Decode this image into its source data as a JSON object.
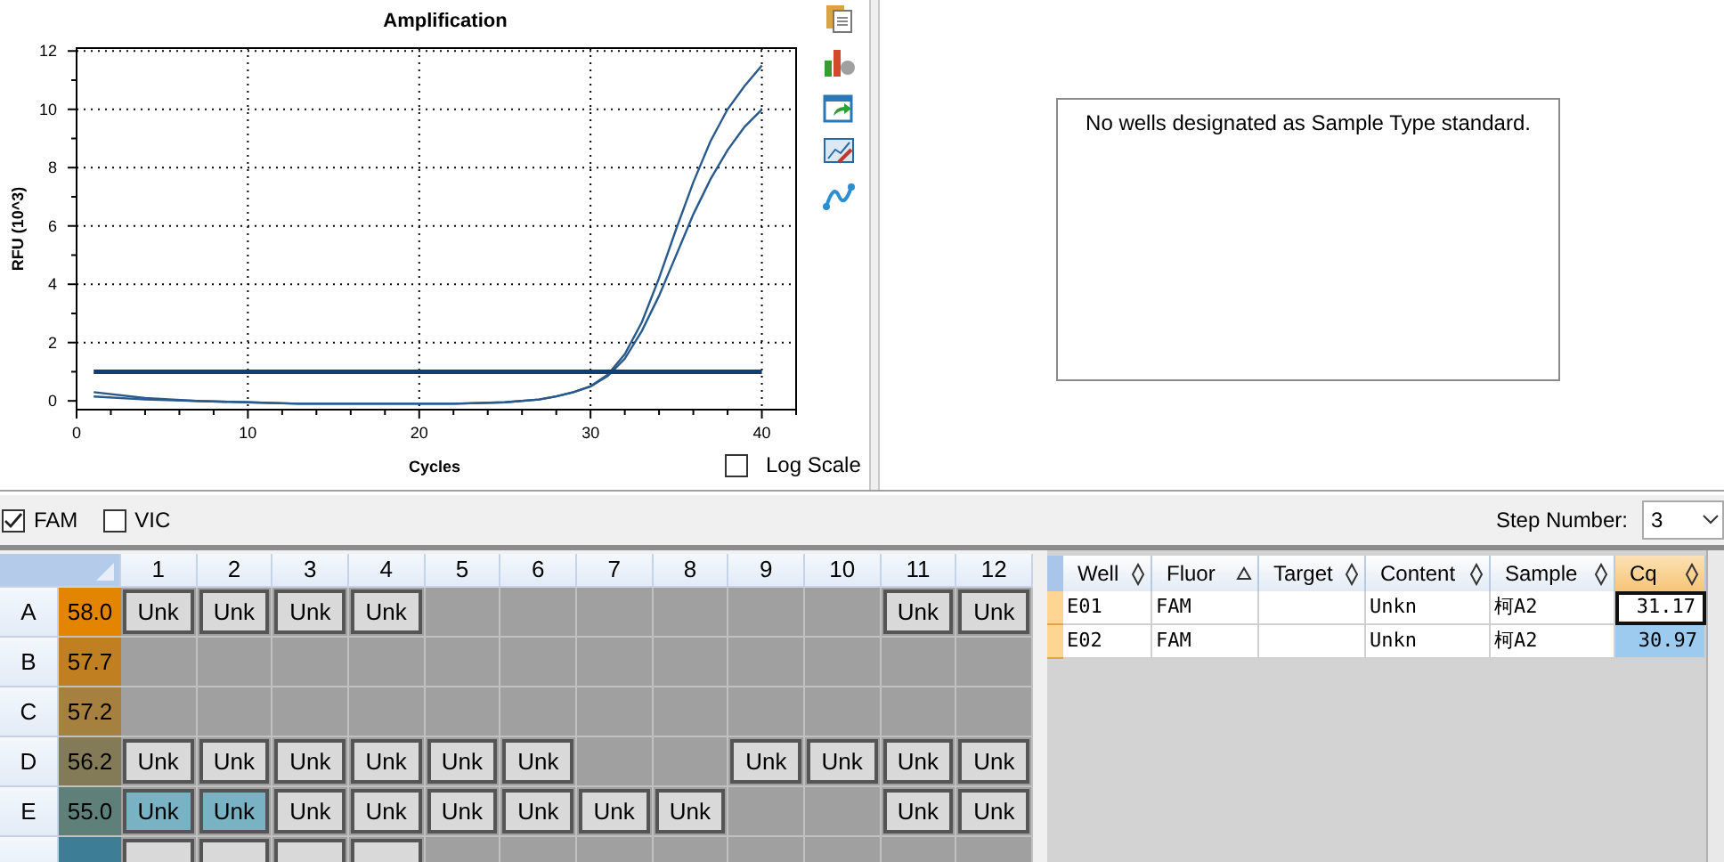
{
  "chart": {
    "chart_data": {
      "type": "line",
      "title": "Amplification",
      "xlabel": "Cycles",
      "ylabel": "RFU (10^3)",
      "grid": true,
      "x": [
        1,
        4,
        7,
        10,
        13,
        16,
        19,
        22,
        25,
        27,
        28,
        29,
        30,
        31,
        32,
        33,
        34,
        35,
        36,
        37,
        38,
        39,
        40
      ],
      "series": [
        {
          "color": "#2a5a8c",
          "values": [
            0.3,
            0.1,
            0.0,
            -0.05,
            -0.1,
            -0.1,
            -0.1,
            -0.1,
            -0.05,
            0.05,
            0.15,
            0.3,
            0.5,
            0.9,
            1.6,
            2.7,
            4.2,
            5.9,
            7.5,
            8.9,
            10.0,
            10.8,
            11.5
          ]
        },
        {
          "color": "#2a5a8c",
          "values": [
            0.15,
            0.05,
            0.0,
            -0.05,
            -0.1,
            -0.1,
            -0.1,
            -0.1,
            -0.05,
            0.05,
            0.15,
            0.3,
            0.5,
            0.85,
            1.45,
            2.4,
            3.6,
            5.0,
            6.4,
            7.6,
            8.6,
            9.4,
            10.0
          ]
        },
        {
          "color": "#0c3f78",
          "values": [
            1,
            1,
            1,
            1,
            1,
            1,
            1,
            1,
            1,
            1,
            1,
            1,
            1,
            1,
            1,
            1,
            1,
            1,
            1,
            1,
            1,
            1,
            1
          ]
        }
      ],
      "xlim": [
        0,
        42
      ],
      "ylim": [
        -0.3,
        12.1
      ],
      "xticks": [
        0,
        10,
        20,
        30,
        40
      ],
      "yticks": [
        0,
        2,
        4,
        6,
        8,
        10,
        12
      ]
    },
    "log_scale": {
      "label": "Log Scale",
      "checked": false
    }
  },
  "standard_curve": {
    "message": "No wells designated as Sample Type standard."
  },
  "fluors": [
    {
      "label": "FAM",
      "checked": true
    },
    {
      "label": "VIC",
      "checked": false
    }
  ],
  "step": {
    "label": "Step Number:",
    "value": "3"
  },
  "plate": {
    "columns": [
      "1",
      "2",
      "3",
      "4",
      "5",
      "6",
      "7",
      "8",
      "9",
      "10",
      "11",
      "12"
    ],
    "rows": [
      {
        "label": "A",
        "temp": "58.0",
        "color": "#e38500",
        "wells": [
          {
            "kind": "sample",
            "text": "Unk",
            "selected": false
          },
          {
            "kind": "sample",
            "text": "Unk",
            "selected": false
          },
          {
            "kind": "sample",
            "text": "Unk",
            "selected": false
          },
          {
            "kind": "sample",
            "text": "Unk",
            "selected": false
          },
          {
            "kind": "empty"
          },
          {
            "kind": "empty"
          },
          {
            "kind": "empty"
          },
          {
            "kind": "empty"
          },
          {
            "kind": "empty"
          },
          {
            "kind": "empty"
          },
          {
            "kind": "sample",
            "text": "Unk",
            "selected": false
          },
          {
            "kind": "sample",
            "text": "Unk",
            "selected": false
          }
        ]
      },
      {
        "label": "B",
        "temp": "57.7",
        "color": "#c07f20",
        "wells": [
          {
            "kind": "empty"
          },
          {
            "kind": "empty"
          },
          {
            "kind": "empty"
          },
          {
            "kind": "empty"
          },
          {
            "kind": "empty"
          },
          {
            "kind": "empty"
          },
          {
            "kind": "empty"
          },
          {
            "kind": "empty"
          },
          {
            "kind": "empty"
          },
          {
            "kind": "empty"
          },
          {
            "kind": "empty"
          },
          {
            "kind": "empty"
          }
        ]
      },
      {
        "label": "C",
        "temp": "57.2",
        "color": "#a5803f",
        "wells": [
          {
            "kind": "empty"
          },
          {
            "kind": "empty"
          },
          {
            "kind": "empty"
          },
          {
            "kind": "empty"
          },
          {
            "kind": "empty"
          },
          {
            "kind": "empty"
          },
          {
            "kind": "empty"
          },
          {
            "kind": "empty"
          },
          {
            "kind": "empty"
          },
          {
            "kind": "empty"
          },
          {
            "kind": "empty"
          },
          {
            "kind": "empty"
          }
        ]
      },
      {
        "label": "D",
        "temp": "56.2",
        "color": "#837b58",
        "wells": [
          {
            "kind": "sample",
            "text": "Unk",
            "selected": false
          },
          {
            "kind": "sample",
            "text": "Unk",
            "selected": false
          },
          {
            "kind": "sample",
            "text": "Unk",
            "selected": false
          },
          {
            "kind": "sample",
            "text": "Unk",
            "selected": false
          },
          {
            "kind": "sample",
            "text": "Unk",
            "selected": false
          },
          {
            "kind": "sample",
            "text": "Unk",
            "selected": false
          },
          {
            "kind": "empty"
          },
          {
            "kind": "empty"
          },
          {
            "kind": "sample",
            "text": "Unk",
            "selected": false
          },
          {
            "kind": "sample",
            "text": "Unk",
            "selected": false
          },
          {
            "kind": "sample",
            "text": "Unk",
            "selected": false
          },
          {
            "kind": "sample",
            "text": "Unk",
            "selected": false
          }
        ]
      },
      {
        "label": "E",
        "temp": "55.0",
        "color": "#5f8079",
        "wells": [
          {
            "kind": "sample",
            "text": "Unk",
            "selected": true
          },
          {
            "kind": "sample",
            "text": "Unk",
            "selected": true
          },
          {
            "kind": "sample",
            "text": "Unk",
            "selected": false
          },
          {
            "kind": "sample",
            "text": "Unk",
            "selected": false
          },
          {
            "kind": "sample",
            "text": "Unk",
            "selected": false
          },
          {
            "kind": "sample",
            "text": "Unk",
            "selected": false
          },
          {
            "kind": "sample",
            "text": "Unk",
            "selected": false
          },
          {
            "kind": "sample",
            "text": "Unk",
            "selected": false
          },
          {
            "kind": "empty"
          },
          {
            "kind": "empty"
          },
          {
            "kind": "sample",
            "text": "Unk",
            "selected": false
          },
          {
            "kind": "sample",
            "text": "Unk",
            "selected": false
          }
        ]
      },
      {
        "color": "#3d7d95",
        "wells": [
          {
            "kind": "sample",
            "selected": false
          },
          {
            "kind": "sample",
            "selected": false
          },
          {
            "kind": "sample",
            "selected": false
          },
          {
            "kind": "sample",
            "selected": false
          },
          {
            "kind": "empty"
          },
          {
            "kind": "empty"
          },
          {
            "kind": "empty"
          },
          {
            "kind": "empty"
          },
          {
            "kind": "empty"
          },
          {
            "kind": "empty"
          },
          {
            "kind": "empty"
          },
          {
            "kind": "empty"
          }
        ]
      }
    ]
  },
  "results": {
    "columns": [
      {
        "label": "Well",
        "sorted": false,
        "highlighted": false
      },
      {
        "label": "Fluor",
        "sorted": true,
        "highlighted": false
      },
      {
        "label": "Target",
        "sorted": false,
        "highlighted": false
      },
      {
        "label": "Content",
        "sorted": false,
        "highlighted": false
      },
      {
        "label": "Sample",
        "sorted": false,
        "highlighted": false
      },
      {
        "label": "Cq",
        "sorted": false,
        "highlighted": true
      }
    ],
    "rows": [
      {
        "cells": [
          "E01",
          "FAM",
          "",
          "Unkn",
          "柯A2",
          "31.17"
        ],
        "focused": true,
        "selected": false
      },
      {
        "cells": [
          "E02",
          "FAM",
          "",
          "Unkn",
          "柯A2",
          "30.97"
        ],
        "focused": false,
        "selected": true
      }
    ]
  }
}
